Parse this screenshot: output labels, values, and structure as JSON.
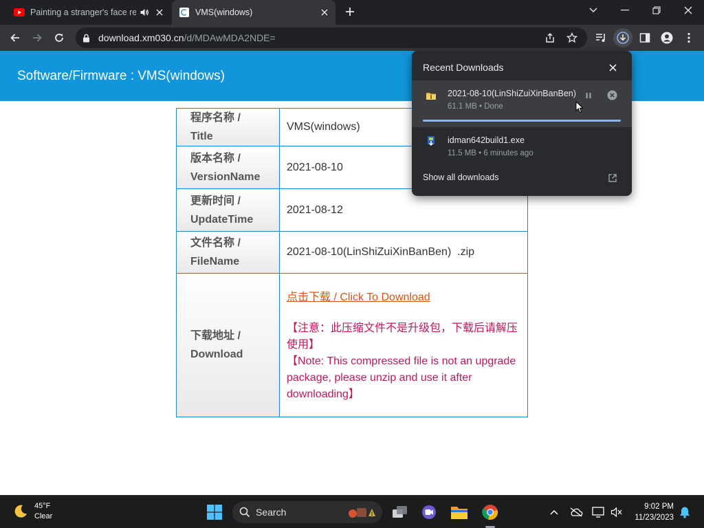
{
  "tabs": [
    {
      "title": "Painting a stranger's face rea",
      "favicon": "youtube-icon",
      "audio": true
    },
    {
      "title": "VMS(windows)",
      "favicon": "page-icon",
      "active": true
    }
  ],
  "toolbar": {
    "url_host": "download.xm030.cn",
    "url_path": "/d/MDAwMDA2NDE="
  },
  "page": {
    "banner_title": "Software/Firmware : VMS(windows)",
    "rows": [
      {
        "label": "程序名称 / Title",
        "value": "VMS(windows)"
      },
      {
        "label": "版本名称 / VersionName",
        "value": "2021-08-10"
      },
      {
        "label": "更新时间 / UpdateTime",
        "value": "2021-08-12"
      },
      {
        "label": "文件名称 / FileName",
        "value": "2021-08-10(LinShiZuiXinBanBen)  .zip"
      }
    ],
    "download": {
      "label": "下载地址 / Download",
      "link_text": "点击下载 / Click To Download",
      "note_cn": "【注意：此压缩文件不是升级包，下载后请解压使用】",
      "note_en": "【Note: This compressed file is not an upgrade package, please unzip and use it after downloading】"
    }
  },
  "downloads": {
    "header": "Recent Downloads",
    "items": [
      {
        "name": "2021-08-10(LinShiZuiXinBanBen)",
        "meta": "61.1 MB • Done",
        "icon": "zip-folder-icon"
      },
      {
        "name": "idman642build1.exe",
        "meta": "11.5 MB • 6 minutes ago",
        "icon": "idm-installer-icon"
      }
    ],
    "show_all": "Show all downloads"
  },
  "taskbar": {
    "weather_temp": "45°F",
    "weather_desc": "Clear",
    "search_label": "Search",
    "time": "9:02 PM",
    "date": "11/23/2023"
  },
  "colors": {
    "banner": "#1296db",
    "table_border": "#1e88c8",
    "link": "#d4571a",
    "note": "#c2185b",
    "download_progress": "#8ab4f8"
  }
}
